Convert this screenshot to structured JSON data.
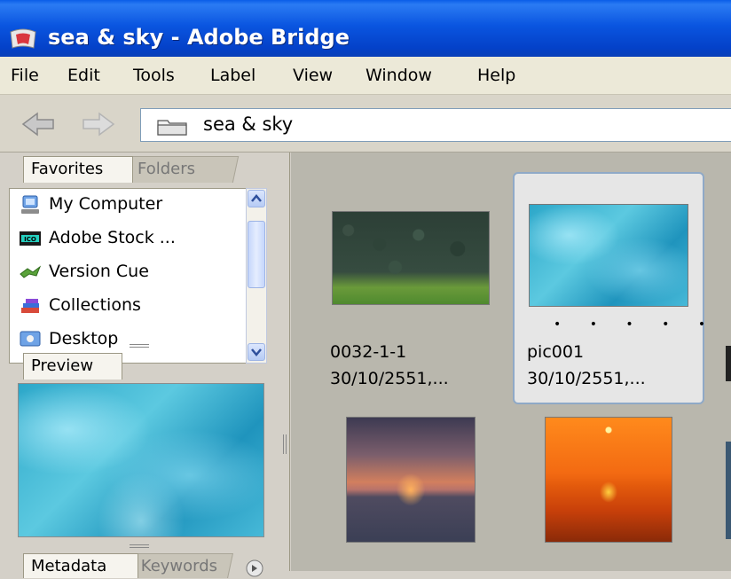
{
  "window": {
    "title": "sea & sky - Adobe Bridge"
  },
  "menu": [
    "File",
    "Edit",
    "Tools",
    "Label",
    "View",
    "Window",
    "Help"
  ],
  "nav": {
    "back_icon": "back-arrow-icon",
    "forward_icon": "forward-arrow-icon",
    "path": "sea & sky"
  },
  "panels": {
    "favorites_tab": "Favorites",
    "folders_tab": "Folders",
    "favorites": [
      {
        "label": "My Computer",
        "icon": "computer-icon"
      },
      {
        "label": "Adobe Stock ...",
        "icon": "stock-photos-icon"
      },
      {
        "label": "Version Cue",
        "icon": "version-cue-icon"
      },
      {
        "label": "Collections",
        "icon": "collections-icon"
      },
      {
        "label": "Desktop",
        "icon": "desktop-icon"
      }
    ],
    "preview_tab": "Preview",
    "metadata_tab": "Metadata",
    "keywords_tab": "Keywords"
  },
  "thumbnails": [
    {
      "name": "0032-1-1",
      "date": "30/10/2551,..."
    },
    {
      "name": "pic001",
      "date": "30/10/2551,...",
      "rating_placeholder": "• • • • •"
    }
  ],
  "colors": {
    "titlebar": "#0a55e0",
    "content_bg": "#b9b7ad",
    "selection_border": "#8fa9c7"
  }
}
